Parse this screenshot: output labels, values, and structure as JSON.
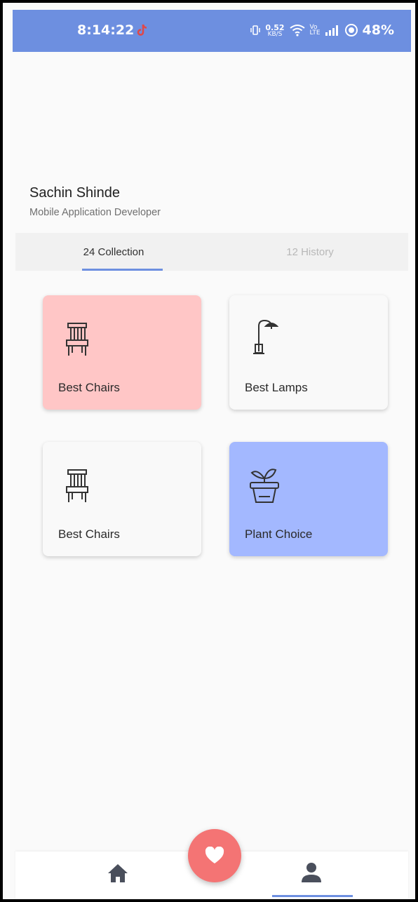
{
  "status_bar": {
    "time": "8:14:22",
    "net_speed_value": "0.52",
    "net_speed_unit": "KB/S",
    "volte_top": "Vo",
    "volte_bottom": "LTE",
    "battery": "48%",
    "bg_color": "#6d8fe0"
  },
  "profile": {
    "name": "Sachin Shinde",
    "role": "Mobile Application Developer"
  },
  "tabs": [
    {
      "label": "24 Collection",
      "active": true
    },
    {
      "label": "12 History",
      "active": false
    }
  ],
  "cards": [
    {
      "label": "Best Chairs",
      "icon": "chair-icon",
      "color": "#ffc6c6"
    },
    {
      "label": "Best Lamps",
      "icon": "lamp-icon",
      "color": "#f9f9f9"
    },
    {
      "label": "Best Chairs",
      "icon": "chair-icon",
      "color": "#f9f9f9"
    },
    {
      "label": "Plant Choice",
      "icon": "plant-icon",
      "color": "#a3b8ff"
    }
  ],
  "bottom_nav": {
    "items": [
      {
        "icon": "home-icon",
        "active": false
      },
      {
        "icon": "profile-icon",
        "active": true
      }
    ],
    "fab_icon": "heart-icon",
    "fab_color": "#f47474",
    "accent": "#6d8fe0"
  }
}
